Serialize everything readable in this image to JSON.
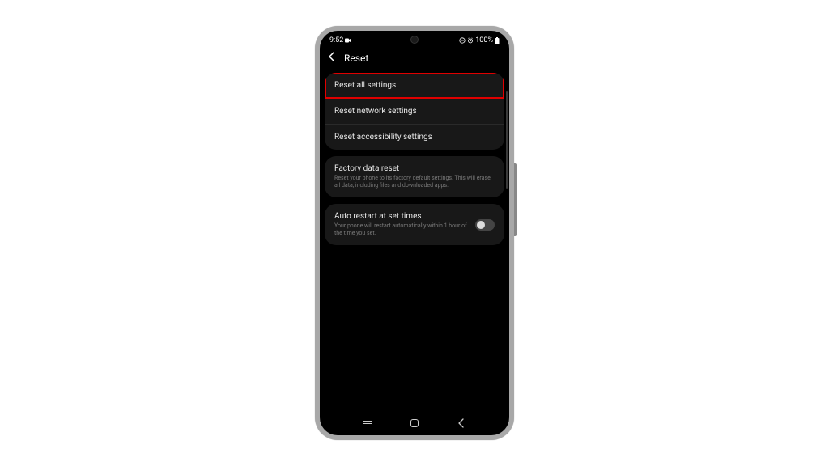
{
  "status": {
    "time": "9:52",
    "battery_text": "100%"
  },
  "header": {
    "title": "Reset"
  },
  "groups": [
    {
      "items": [
        {
          "title": "Reset all settings",
          "highlight": true
        },
        {
          "title": "Reset network settings"
        },
        {
          "title": "Reset accessibility settings"
        }
      ]
    },
    {
      "items": [
        {
          "title": "Factory data reset",
          "sub": "Reset your phone to its factory default settings. This will erase all data, including files and downloaded apps."
        }
      ]
    },
    {
      "items": [
        {
          "title": "Auto restart at set times",
          "sub": "Your phone will restart automatically within 1 hour of the time you set.",
          "toggle": false
        }
      ]
    }
  ]
}
